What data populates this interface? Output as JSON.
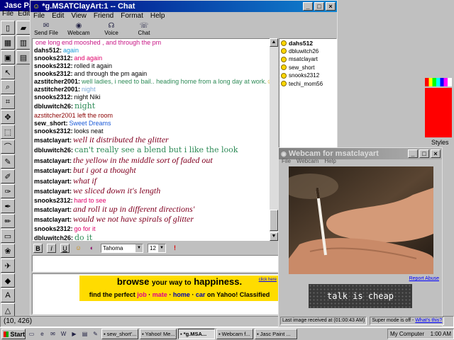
{
  "paint": {
    "title": "Jasc Pa",
    "menu": [
      "File",
      "Edit"
    ],
    "status": "(10, 426)",
    "styles_label": "Styles"
  },
  "chat": {
    "title": "*g.MSATClayArt:1 -- Chat",
    "menu": [
      "File",
      "Edit",
      "View",
      "Friend",
      "Format",
      "Help"
    ],
    "toolbar": [
      {
        "label": "Send File",
        "icon": "send-file-icon"
      },
      {
        "label": "Webcam",
        "icon": "webcam-icon"
      },
      {
        "label": "Voice",
        "icon": "voice-icon"
      },
      {
        "label": "Chat",
        "icon": "chat-icon"
      }
    ],
    "messages": [
      {
        "user": "",
        "text": "one long end mooshed , and through the pm",
        "color": "#c71585",
        "style": "normal"
      },
      {
        "user": "dahs512:",
        "text": "again",
        "color": "#1a9bd7",
        "style": "normal"
      },
      {
        "user": "snooks2312:",
        "text": "and again",
        "color": "#e0006a",
        "style": "normal"
      },
      {
        "user": "snooks2312:",
        "text": "rolled it again",
        "color": "#000000",
        "style": "normal"
      },
      {
        "user": "snooks2312:",
        "text": "and through the pm again",
        "color": "#000000",
        "style": "normal"
      },
      {
        "user": "azstitcher2001:",
        "text": "well ladies, i need to bail.. heading home from a long day at work.",
        "color": "#2e8b57",
        "style": "normal",
        "emoji": "☺"
      },
      {
        "user": "azstitcher2001:",
        "text": "night",
        "color": "#7aa7d6",
        "style": "normal"
      },
      {
        "user": "snooks2312:",
        "text": "night Niki",
        "color": "#000000",
        "style": "normal"
      },
      {
        "user": "dbluwitch26:",
        "text": "night",
        "color": "#2e8b57",
        "style": "fancy"
      },
      {
        "user": "",
        "text": "azstitcher2001 left the room",
        "color": "#8b0000",
        "style": "system"
      },
      {
        "user": "sew_short:",
        "text": "Sweet Dreams",
        "color": "#1a5ad7",
        "style": "normal"
      },
      {
        "user": "snooks2312:",
        "text": "looks neat",
        "color": "#000000",
        "style": "normal"
      },
      {
        "user": "msatclayart:",
        "text": "well it distributed the glitter",
        "color": "#800020",
        "style": "script"
      },
      {
        "user": "dbluwitch26:",
        "text": "can't really see a blend but i like the look",
        "color": "#2e8b57",
        "style": "fancy"
      },
      {
        "user": "msatclayart:",
        "text": "the yellow in the middle sort of faded out",
        "color": "#800020",
        "style": "script"
      },
      {
        "user": "msatclayart:",
        "text": "but i got a thought",
        "color": "#800020",
        "style": "script"
      },
      {
        "user": "msatclayart:",
        "text": "what if",
        "color": "#800020",
        "style": "script"
      },
      {
        "user": "msatclayart:",
        "text": "we sliced down it's length",
        "color": "#800020",
        "style": "script"
      },
      {
        "user": "snooks2312:",
        "text": "hard to see",
        "color": "#e0006a",
        "style": "normal"
      },
      {
        "user": "msatclayart:",
        "text": "and roll it up in different directions'",
        "color": "#800020",
        "style": "script"
      },
      {
        "user": "msatclayart:",
        "text": "would we not have spirals of glitter",
        "color": "#800020",
        "style": "script"
      },
      {
        "user": "snooks2312:",
        "text": "go for it",
        "color": "#e0006a",
        "style": "normal"
      },
      {
        "user": "dbluwitch26:",
        "text": "do it",
        "color": "#2e8b57",
        "style": "fancy"
      }
    ],
    "buddies": [
      "dahs512",
      "dbluwitch26",
      "msatclayart",
      "sew_short",
      "snooks2312",
      "techi_mom56"
    ],
    "selected_buddy": "dahs512",
    "format": {
      "bold": "B",
      "italic": "I",
      "underline": "U",
      "font": "Tahoma",
      "size": "12"
    },
    "ad": {
      "browse": "browse",
      "mid1": "your way to",
      "happiness": "happiness.",
      "click": "click here",
      "find": "find the perfect",
      "job": "job",
      "mate": "mate",
      "home": "home",
      "car": "car",
      "tail": "on Yahoo! Classified",
      "sep": "·"
    }
  },
  "webcam": {
    "title": "Webcam for msatclayart",
    "menu": [
      "File",
      "Webcam",
      "Help"
    ],
    "report": "Report Abuse",
    "tagline": "talk is cheap",
    "last_image": "Last image received at (01:00:43 AM)",
    "super_mode": "Super mode is off -",
    "whats_this": "What's this?"
  },
  "taskbar": {
    "start": "Start",
    "tasks": [
      "sew_short'...",
      "Yahoo! Me...",
      "*g.MSA...",
      "Webcam f...",
      "Jasc Paint ..."
    ],
    "active_index": 2,
    "tray_label": "My Computer",
    "clock": "1:00 AM"
  },
  "colors": {
    "title_active": "#000080",
    "ad_yellow": "#ffdc00"
  }
}
